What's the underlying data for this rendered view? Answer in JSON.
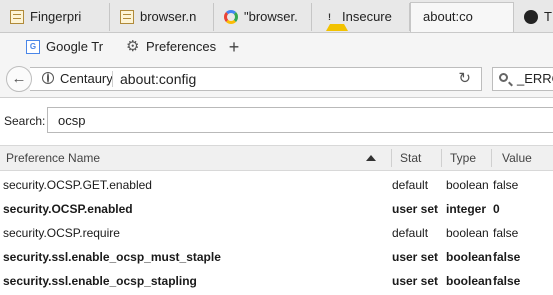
{
  "tabs": [
    {
      "label": "Fingerpri",
      "icon": "document-icon"
    },
    {
      "label": "browser.n",
      "icon": "document-icon"
    },
    {
      "label": "\"browser.",
      "icon": "google-icon"
    },
    {
      "label": "Insecure",
      "icon": "warning-icon"
    },
    {
      "label": "about:co",
      "icon": "none",
      "active": true
    },
    {
      "label": "T",
      "icon": "github-icon"
    }
  ],
  "bookmarks": [
    {
      "label": "Google Tr",
      "icon": "google-translate-icon"
    },
    {
      "label": "Preferences",
      "icon": "gear-icon"
    }
  ],
  "navbar": {
    "identity_label": "Centaury",
    "url": "about:config",
    "search_value": "_ERRO"
  },
  "filter": {
    "label": "Search:",
    "value": "ocsp"
  },
  "table": {
    "columns": [
      "Preference Name",
      "Stat",
      "Type",
      "Value"
    ],
    "rows": [
      {
        "name": "security.OCSP.GET.enabled",
        "status": "default",
        "type": "boolean",
        "value": "false",
        "modified": false
      },
      {
        "name": "security.OCSP.enabled",
        "status": "user set",
        "type": "integer",
        "value": "0",
        "modified": true
      },
      {
        "name": "security.OCSP.require",
        "status": "default",
        "type": "boolean",
        "value": "false",
        "modified": false
      },
      {
        "name": "security.ssl.enable_ocsp_must_staple",
        "status": "user set",
        "type": "boolean",
        "value": "false",
        "modified": true
      },
      {
        "name": "security.ssl.enable_ocsp_stapling",
        "status": "user set",
        "type": "boolean",
        "value": "false",
        "modified": true
      }
    ]
  },
  "colors": {
    "tabstrip_bg": "#e8e8e8",
    "header_bg": "#f0f0f0",
    "warning": "#f2c200",
    "google_blue": "#4285f4"
  }
}
